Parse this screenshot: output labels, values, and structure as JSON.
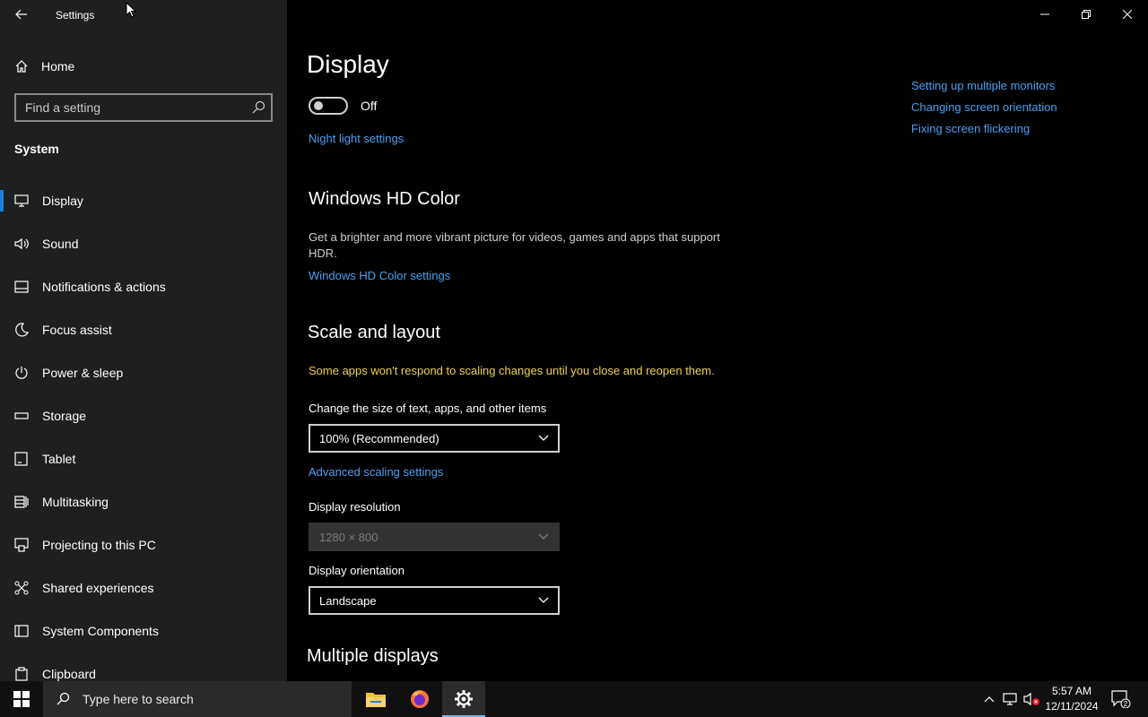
{
  "window": {
    "app_title": "Settings"
  },
  "sidebar": {
    "home_label": "Home",
    "search_placeholder": "Find a setting",
    "section_label": "System",
    "items": [
      {
        "label": "Display",
        "icon": "monitor-icon",
        "active": true
      },
      {
        "label": "Sound",
        "icon": "speaker-icon"
      },
      {
        "label": "Notifications & actions",
        "icon": "notification-icon"
      },
      {
        "label": "Focus assist",
        "icon": "moon-icon"
      },
      {
        "label": "Power & sleep",
        "icon": "power-icon"
      },
      {
        "label": "Storage",
        "icon": "storage-icon"
      },
      {
        "label": "Tablet",
        "icon": "tablet-icon"
      },
      {
        "label": "Multitasking",
        "icon": "multitasking-icon"
      },
      {
        "label": "Projecting to this PC",
        "icon": "projecting-icon"
      },
      {
        "label": "Shared experiences",
        "icon": "shared-experiences-icon"
      },
      {
        "label": "System Components",
        "icon": "system-components-icon"
      },
      {
        "label": "Clipboard",
        "icon": "clipboard-icon"
      }
    ]
  },
  "main": {
    "page_title": "Display",
    "night_light": {
      "toggle_state": "Off",
      "settings_link": "Night light settings"
    },
    "hd_color": {
      "heading": "Windows HD Color",
      "description": "Get a brighter and more vibrant picture for videos, games and apps that support HDR.",
      "settings_link": "Windows HD Color settings"
    },
    "scale_layout": {
      "heading": "Scale and layout",
      "warning": "Some apps won't respond to scaling changes until you close and reopen them.",
      "size_label": "Change the size of text, apps, and other items",
      "size_value": "100% (Recommended)",
      "advanced_link": "Advanced scaling settings",
      "resolution_label": "Display resolution",
      "resolution_value": "1280 × 800",
      "orientation_label": "Display orientation",
      "orientation_value": "Landscape"
    },
    "multiple_displays_heading": "Multiple displays",
    "related_links": [
      "Setting up multiple monitors",
      "Changing screen orientation",
      "Fixing screen flickering"
    ]
  },
  "taskbar": {
    "search_placeholder": "Type here to search",
    "time": "5:57 AM",
    "date": "12/11/2024",
    "notification_count": "2"
  },
  "colors": {
    "accent": "#1a7fe0",
    "link": "#4ca0f0",
    "warning": "#f0d24a",
    "sidebar_bg": "#1f1f1f"
  }
}
